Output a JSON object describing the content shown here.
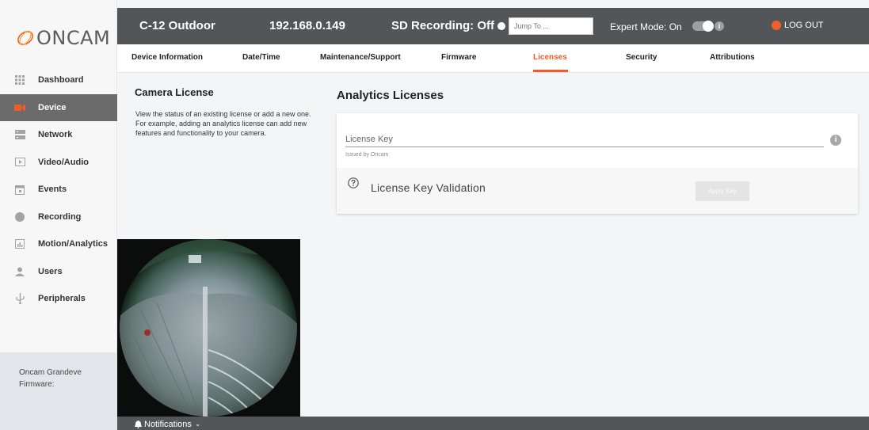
{
  "header": {
    "device_name": "C-12 Outdoor",
    "ip_address": "192.168.0.149",
    "sd_recording": "SD Recording: Off",
    "jump_placeholder": "Jump To ...",
    "expert_mode": "Expert Mode: On",
    "logout": "LOG OUT"
  },
  "brand": {
    "logo_text": "ONCAM",
    "accent": "#f05d2a"
  },
  "tabs": [
    {
      "label": "Device Information"
    },
    {
      "label": "Date/Time"
    },
    {
      "label": "Maintenance/Support"
    },
    {
      "label": "Firmware"
    },
    {
      "label": "Licenses"
    },
    {
      "label": "Security"
    },
    {
      "label": "Attributions"
    }
  ],
  "sidebar": {
    "items": [
      {
        "label": "Dashboard",
        "icon": "grid-icon"
      },
      {
        "label": "Device",
        "icon": "camera-icon"
      },
      {
        "label": "Network",
        "icon": "network-icon"
      },
      {
        "label": "Video/Audio",
        "icon": "video-icon"
      },
      {
        "label": "Events",
        "icon": "calendar-icon"
      },
      {
        "label": "Recording",
        "icon": "record-icon"
      },
      {
        "label": "Motion/Analytics",
        "icon": "chart-icon"
      },
      {
        "label": "Users",
        "icon": "user-icon"
      },
      {
        "label": "Peripherals",
        "icon": "usb-icon"
      }
    ],
    "footer_product": "Oncam Grandeve",
    "footer_firmware": "Firmware:"
  },
  "camera_license": {
    "title": "Camera License",
    "description": "View the status of an existing license or add a new one. For example, adding an analytics license can add new features and functionality to your camera."
  },
  "analytics": {
    "title": "Analytics Licenses",
    "key_label": "License Key",
    "key_help": "Issued by Oncam",
    "validation_title": "License Key Validation",
    "apply_button": "Apply Key"
  },
  "notifications": {
    "label": "Notifications"
  }
}
